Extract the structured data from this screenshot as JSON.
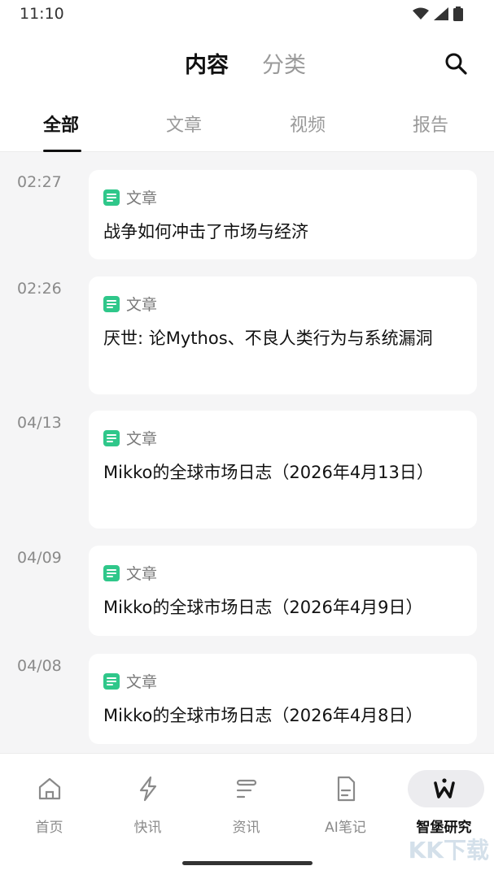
{
  "status": {
    "time": "11:10"
  },
  "header": {
    "tabs": [
      {
        "label": "内容"
      },
      {
        "label": "分类"
      }
    ]
  },
  "subtabs": [
    {
      "label": "全部"
    },
    {
      "label": "文章"
    },
    {
      "label": "视频"
    },
    {
      "label": "报告"
    }
  ],
  "feed": [
    {
      "time": "02:27",
      "type": "文章",
      "title": "战争如何冲击了市场与经济"
    },
    {
      "time": "02:26",
      "type": "文章",
      "title": "厌世: 论Mythos、不良人类行为与系统漏洞"
    },
    {
      "time": "04/13",
      "type": "文章",
      "title": "Mikko的全球市场日志（2026年4月13日）"
    },
    {
      "time": "04/09",
      "type": "文章",
      "title": "Mikko的全球市场日志（2026年4月9日）"
    },
    {
      "time": "04/08",
      "type": "文章",
      "title": "Mikko的全球市场日志（2026年4月8日）"
    }
  ],
  "tabbar": [
    {
      "label": "首页",
      "icon": "home-icon"
    },
    {
      "label": "快讯",
      "icon": "lightning-icon"
    },
    {
      "label": "资讯",
      "icon": "news-icon"
    },
    {
      "label": "AI笔记",
      "icon": "document-icon"
    },
    {
      "label": "智堡研究",
      "icon": "brand-w-icon"
    }
  ],
  "watermark": "KK下载",
  "colors": {
    "accent_green": "#2fc78a",
    "background": "#f5f5f6"
  }
}
